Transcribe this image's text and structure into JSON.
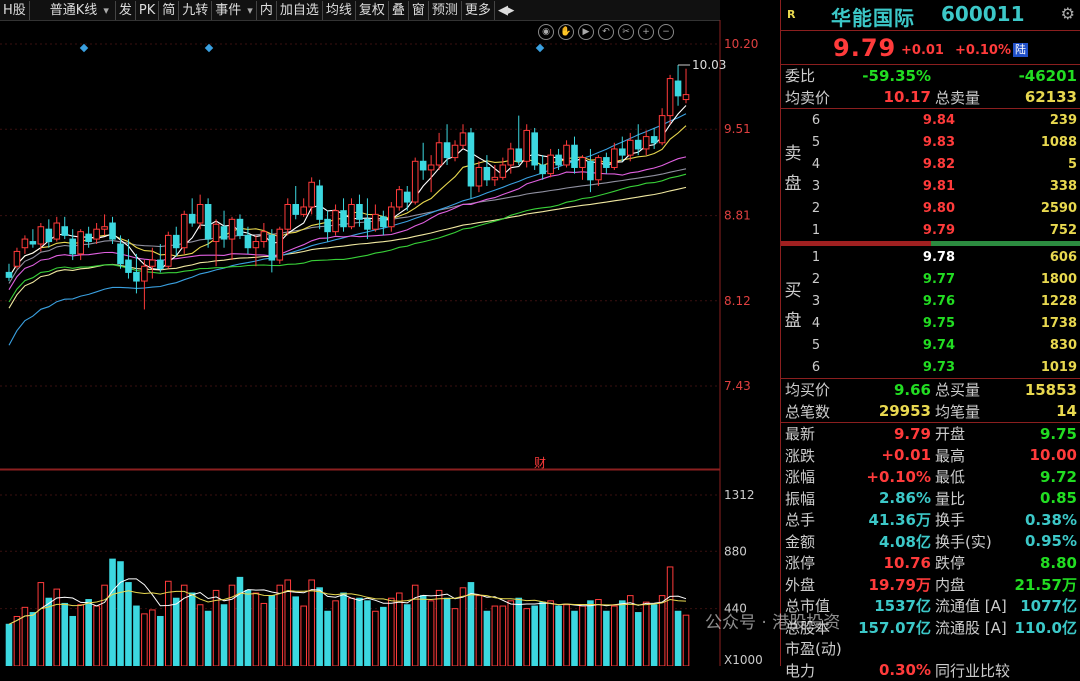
{
  "toolbar": {
    "items": [
      "H股",
      "普通K线",
      "发",
      "PK",
      "简",
      "九转",
      "事件",
      "内",
      "加自选",
      "均线",
      "复权",
      "叠",
      "窗",
      "预测",
      "更多"
    ],
    "dropdowns": [
      1,
      6
    ]
  },
  "chart": {
    "price_ticks": [
      "10.20",
      "9.51",
      "8.81",
      "8.12",
      "7.43"
    ],
    "vol_ticks": [
      "1312",
      "880",
      "440",
      "X1000"
    ],
    "high_label": "10.03",
    "fin_badge": "财"
  },
  "stock": {
    "logo": "R",
    "name": "华能国际",
    "code": "600011",
    "price": "9.79",
    "change": "+0.01",
    "change_pct": "+0.10%",
    "exchange_badge": "陆"
  },
  "stats_top": [
    {
      "l1": "委比",
      "v1": "-59.35%",
      "c1": "grn",
      "l2": "",
      "v2": "-46201",
      "c2": "grn"
    },
    {
      "l1": "均卖价",
      "v1": "10.17",
      "c1": "red",
      "l2": "总卖量",
      "v2": "62133",
      "c2": "yel"
    }
  ],
  "ask_label": "卖 盘",
  "asks": [
    {
      "n": "6",
      "p": "9.84",
      "v": "239"
    },
    {
      "n": "5",
      "p": "9.83",
      "v": "1088"
    },
    {
      "n": "4",
      "p": "9.82",
      "v": "5"
    },
    {
      "n": "3",
      "p": "9.81",
      "v": "338"
    },
    {
      "n": "2",
      "p": "9.80",
      "v": "2590"
    },
    {
      "n": "1",
      "p": "9.79",
      "v": "752"
    }
  ],
  "bid_label": "买 盘",
  "bids": [
    {
      "n": "1",
      "p": "9.78",
      "v": "606",
      "c": "wht"
    },
    {
      "n": "2",
      "p": "9.77",
      "v": "1800",
      "c": "grn"
    },
    {
      "n": "3",
      "p": "9.76",
      "v": "1228",
      "c": "grn"
    },
    {
      "n": "4",
      "p": "9.75",
      "v": "1738",
      "c": "grn"
    },
    {
      "n": "5",
      "p": "9.74",
      "v": "830",
      "c": "grn"
    },
    {
      "n": "6",
      "p": "9.73",
      "v": "1019",
      "c": "grn"
    }
  ],
  "stats_mid": [
    {
      "l1": "均买价",
      "v1": "9.66",
      "c1": "grn",
      "l2": "总买量",
      "v2": "15853",
      "c2": "yel"
    },
    {
      "l1": "总笔数",
      "v1": "29953",
      "c1": "yel",
      "l2": "均笔量",
      "v2": "14",
      "c2": "yel"
    }
  ],
  "stats_bot": [
    {
      "l1": "最新",
      "v1": "9.79",
      "c1": "red",
      "l2": "开盘",
      "v2": "9.75",
      "c2": "grn"
    },
    {
      "l1": "涨跌",
      "v1": "+0.01",
      "c1": "red",
      "l2": "最高",
      "v2": "10.00",
      "c2": "red"
    },
    {
      "l1": "涨幅",
      "v1": "+0.10%",
      "c1": "red",
      "l2": "最低",
      "v2": "9.72",
      "c2": "grn"
    },
    {
      "l1": "振幅",
      "v1": "2.86%",
      "c1": "cyn",
      "l2": "量比",
      "v2": "0.85",
      "c2": "grn"
    },
    {
      "l1": "总手",
      "v1": "41.36万",
      "c1": "cyn",
      "l2": "换手",
      "v2": "0.38%",
      "c2": "cyn"
    },
    {
      "l1": "金额",
      "v1": "4.08亿",
      "c1": "cyn",
      "l2": "换手(实)",
      "v2": "0.95%",
      "c2": "cyn"
    },
    {
      "l1": "涨停",
      "v1": "10.76",
      "c1": "red",
      "l2": "跌停",
      "v2": "8.80",
      "c2": "grn"
    },
    {
      "l1": "外盘",
      "v1": "19.79万",
      "c1": "red",
      "l2": "内盘",
      "v2": "21.57万",
      "c2": "grn"
    },
    {
      "l1": "总市值",
      "v1": "1537亿",
      "c1": "cyn",
      "l2": "流通值 [A]",
      "v2": "1077亿",
      "c2": "cyn"
    },
    {
      "l1": "总股本",
      "v1": "157.07亿",
      "c1": "cyn",
      "l2": "流通股 [A]",
      "v2": "110.0亿",
      "c2": "cyn"
    },
    {
      "l1": "市盈(动)",
      "v1": "",
      "c1": "cyn",
      "l2": "",
      "v2": "",
      "c2": "cyn"
    },
    {
      "l1": "电力",
      "v1": "0.30%",
      "c1": "red",
      "l2": "同行业比较",
      "v2": "",
      "c2": "cyn"
    }
  ],
  "watermark": "公众号 · 港股投资",
  "colors": {
    "up": "#ff3b3b",
    "down": "#3cd8e0",
    "ma5": "#ffffff",
    "ma10": "#e8d84f",
    "ma20": "#e060e0",
    "ma30": "#38d038",
    "ma60": "#3aa0e0",
    "ma120": "#9090a0",
    "ma250": "#f0e8a0"
  },
  "chart_data": {
    "type": "candlestick",
    "ylim": [
      7.43,
      10.2
    ],
    "vol_ylim": [
      0,
      1312
    ],
    "candles": [
      {
        "o": 8.35,
        "h": 8.42,
        "l": 8.28,
        "c": 8.31,
        "v": 320
      },
      {
        "o": 8.4,
        "h": 8.55,
        "l": 8.38,
        "c": 8.52,
        "v": 380
      },
      {
        "o": 8.55,
        "h": 8.65,
        "l": 8.5,
        "c": 8.62,
        "v": 450
      },
      {
        "o": 8.6,
        "h": 8.7,
        "l": 8.55,
        "c": 8.58,
        "v": 410
      },
      {
        "o": 8.58,
        "h": 8.75,
        "l": 8.52,
        "c": 8.72,
        "v": 640
      },
      {
        "o": 8.7,
        "h": 8.78,
        "l": 8.55,
        "c": 8.6,
        "v": 520
      },
      {
        "o": 8.62,
        "h": 8.8,
        "l": 8.6,
        "c": 8.75,
        "v": 590
      },
      {
        "o": 8.72,
        "h": 8.8,
        "l": 8.62,
        "c": 8.65,
        "v": 480
      },
      {
        "o": 8.62,
        "h": 8.7,
        "l": 8.45,
        "c": 8.5,
        "v": 380
      },
      {
        "o": 8.5,
        "h": 8.7,
        "l": 8.45,
        "c": 8.68,
        "v": 470
      },
      {
        "o": 8.66,
        "h": 8.72,
        "l": 8.55,
        "c": 8.6,
        "v": 510
      },
      {
        "o": 8.62,
        "h": 8.75,
        "l": 8.58,
        "c": 8.7,
        "v": 460
      },
      {
        "o": 8.7,
        "h": 8.82,
        "l": 8.65,
        "c": 8.72,
        "v": 620
      },
      {
        "o": 8.75,
        "h": 8.8,
        "l": 8.58,
        "c": 8.62,
        "v": 820
      },
      {
        "o": 8.58,
        "h": 8.65,
        "l": 8.38,
        "c": 8.42,
        "v": 800
      },
      {
        "o": 8.45,
        "h": 8.62,
        "l": 8.3,
        "c": 8.35,
        "v": 640
      },
      {
        "o": 8.35,
        "h": 8.5,
        "l": 8.18,
        "c": 8.28,
        "v": 460
      },
      {
        "o": 8.28,
        "h": 8.45,
        "l": 8.05,
        "c": 8.4,
        "v": 400
      },
      {
        "o": 8.4,
        "h": 8.55,
        "l": 8.3,
        "c": 8.45,
        "v": 430
      },
      {
        "o": 8.45,
        "h": 8.58,
        "l": 8.35,
        "c": 8.38,
        "v": 380
      },
      {
        "o": 8.4,
        "h": 8.68,
        "l": 8.38,
        "c": 8.65,
        "v": 650
      },
      {
        "o": 8.65,
        "h": 8.72,
        "l": 8.48,
        "c": 8.55,
        "v": 520
      },
      {
        "o": 8.55,
        "h": 8.85,
        "l": 8.5,
        "c": 8.82,
        "v": 620
      },
      {
        "o": 8.82,
        "h": 8.95,
        "l": 8.72,
        "c": 8.75,
        "v": 560
      },
      {
        "o": 8.75,
        "h": 8.98,
        "l": 8.7,
        "c": 8.9,
        "v": 470
      },
      {
        "o": 8.9,
        "h": 8.95,
        "l": 8.55,
        "c": 8.62,
        "v": 420
      },
      {
        "o": 8.6,
        "h": 8.78,
        "l": 8.4,
        "c": 8.74,
        "v": 580
      },
      {
        "o": 8.72,
        "h": 8.85,
        "l": 8.55,
        "c": 8.62,
        "v": 470
      },
      {
        "o": 8.62,
        "h": 8.8,
        "l": 8.45,
        "c": 8.78,
        "v": 620
      },
      {
        "o": 8.78,
        "h": 8.82,
        "l": 8.62,
        "c": 8.65,
        "v": 680
      },
      {
        "o": 8.65,
        "h": 8.72,
        "l": 8.5,
        "c": 8.55,
        "v": 580
      },
      {
        "o": 8.55,
        "h": 8.65,
        "l": 8.4,
        "c": 8.6,
        "v": 560
      },
      {
        "o": 8.6,
        "h": 8.75,
        "l": 8.55,
        "c": 8.68,
        "v": 480
      },
      {
        "o": 8.65,
        "h": 8.7,
        "l": 8.35,
        "c": 8.45,
        "v": 540
      },
      {
        "o": 8.45,
        "h": 8.72,
        "l": 8.42,
        "c": 8.7,
        "v": 620
      },
      {
        "o": 8.7,
        "h": 8.95,
        "l": 8.65,
        "c": 8.9,
        "v": 660
      },
      {
        "o": 8.9,
        "h": 9.05,
        "l": 8.78,
        "c": 8.82,
        "v": 530
      },
      {
        "o": 8.82,
        "h": 8.95,
        "l": 8.8,
        "c": 8.88,
        "v": 460
      },
      {
        "o": 8.88,
        "h": 9.12,
        "l": 8.82,
        "c": 9.08,
        "v": 660
      },
      {
        "o": 9.05,
        "h": 9.1,
        "l": 8.7,
        "c": 8.78,
        "v": 600
      },
      {
        "o": 8.78,
        "h": 8.85,
        "l": 8.6,
        "c": 8.68,
        "v": 420
      },
      {
        "o": 8.68,
        "h": 8.9,
        "l": 8.65,
        "c": 8.85,
        "v": 500
      },
      {
        "o": 8.85,
        "h": 8.95,
        "l": 8.68,
        "c": 8.72,
        "v": 560
      },
      {
        "o": 8.72,
        "h": 8.95,
        "l": 8.7,
        "c": 8.9,
        "v": 520
      },
      {
        "o": 8.9,
        "h": 8.98,
        "l": 8.72,
        "c": 8.78,
        "v": 520
      },
      {
        "o": 8.78,
        "h": 8.95,
        "l": 8.62,
        "c": 8.7,
        "v": 500
      },
      {
        "o": 8.7,
        "h": 8.9,
        "l": 8.68,
        "c": 8.82,
        "v": 420
      },
      {
        "o": 8.8,
        "h": 8.85,
        "l": 8.65,
        "c": 8.72,
        "v": 450
      },
      {
        "o": 8.72,
        "h": 8.92,
        "l": 8.68,
        "c": 8.88,
        "v": 520
      },
      {
        "o": 8.88,
        "h": 9.05,
        "l": 8.85,
        "c": 9.02,
        "v": 560
      },
      {
        "o": 9.0,
        "h": 9.05,
        "l": 8.85,
        "c": 8.92,
        "v": 470
      },
      {
        "o": 8.92,
        "h": 9.28,
        "l": 8.9,
        "c": 9.25,
        "v": 620
      },
      {
        "o": 9.25,
        "h": 9.4,
        "l": 9.1,
        "c": 9.18,
        "v": 540
      },
      {
        "o": 9.18,
        "h": 9.3,
        "l": 9.0,
        "c": 9.22,
        "v": 500
      },
      {
        "o": 9.22,
        "h": 9.48,
        "l": 9.18,
        "c": 9.4,
        "v": 580
      },
      {
        "o": 9.4,
        "h": 9.55,
        "l": 9.22,
        "c": 9.28,
        "v": 520
      },
      {
        "o": 9.28,
        "h": 9.42,
        "l": 9.25,
        "c": 9.38,
        "v": 440
      },
      {
        "o": 9.38,
        "h": 9.55,
        "l": 9.35,
        "c": 9.48,
        "v": 600
      },
      {
        "o": 9.48,
        "h": 9.52,
        "l": 8.95,
        "c": 9.05,
        "v": 640
      },
      {
        "o": 9.05,
        "h": 9.25,
        "l": 9.0,
        "c": 9.2,
        "v": 540
      },
      {
        "o": 9.2,
        "h": 9.3,
        "l": 9.05,
        "c": 9.1,
        "v": 420
      },
      {
        "o": 9.1,
        "h": 9.22,
        "l": 9.05,
        "c": 9.12,
        "v": 460
      },
      {
        "o": 9.12,
        "h": 9.28,
        "l": 9.1,
        "c": 9.22,
        "v": 460
      },
      {
        "o": 9.22,
        "h": 9.4,
        "l": 9.15,
        "c": 9.35,
        "v": 500
      },
      {
        "o": 9.35,
        "h": 9.62,
        "l": 9.22,
        "c": 9.25,
        "v": 520
      },
      {
        "o": 9.25,
        "h": 9.55,
        "l": 9.2,
        "c": 9.5,
        "v": 440
      },
      {
        "o": 9.48,
        "h": 9.52,
        "l": 9.18,
        "c": 9.22,
        "v": 460
      },
      {
        "o": 9.22,
        "h": 9.3,
        "l": 9.1,
        "c": 9.15,
        "v": 490
      },
      {
        "o": 9.15,
        "h": 9.35,
        "l": 9.12,
        "c": 9.3,
        "v": 500
      },
      {
        "o": 9.3,
        "h": 9.35,
        "l": 9.18,
        "c": 9.22,
        "v": 460
      },
      {
        "o": 9.22,
        "h": 9.42,
        "l": 9.2,
        "c": 9.38,
        "v": 470
      },
      {
        "o": 9.38,
        "h": 9.45,
        "l": 9.15,
        "c": 9.2,
        "v": 420
      },
      {
        "o": 9.2,
        "h": 9.3,
        "l": 9.1,
        "c": 9.28,
        "v": 460
      },
      {
        "o": 9.25,
        "h": 9.35,
        "l": 9.0,
        "c": 9.1,
        "v": 500
      },
      {
        "o": 9.1,
        "h": 9.3,
        "l": 9.05,
        "c": 9.28,
        "v": 510
      },
      {
        "o": 9.28,
        "h": 9.32,
        "l": 9.15,
        "c": 9.2,
        "v": 420
      },
      {
        "o": 9.2,
        "h": 9.4,
        "l": 9.18,
        "c": 9.35,
        "v": 460
      },
      {
        "o": 9.35,
        "h": 9.45,
        "l": 9.25,
        "c": 9.3,
        "v": 500
      },
      {
        "o": 9.3,
        "h": 9.48,
        "l": 9.25,
        "c": 9.42,
        "v": 540
      },
      {
        "o": 9.42,
        "h": 9.55,
        "l": 9.3,
        "c": 9.35,
        "v": 410
      },
      {
        "o": 9.35,
        "h": 9.5,
        "l": 9.3,
        "c": 9.45,
        "v": 490
      },
      {
        "o": 9.45,
        "h": 9.52,
        "l": 9.35,
        "c": 9.4,
        "v": 470
      },
      {
        "o": 9.4,
        "h": 9.68,
        "l": 9.38,
        "c": 9.62,
        "v": 540
      },
      {
        "o": 9.62,
        "h": 9.95,
        "l": 9.55,
        "c": 9.92,
        "v": 760
      },
      {
        "o": 9.9,
        "h": 10.03,
        "l": 9.7,
        "c": 9.78,
        "v": 420
      },
      {
        "o": 9.75,
        "h": 10.0,
        "l": 9.72,
        "c": 9.79,
        "v": 390
      }
    ]
  }
}
